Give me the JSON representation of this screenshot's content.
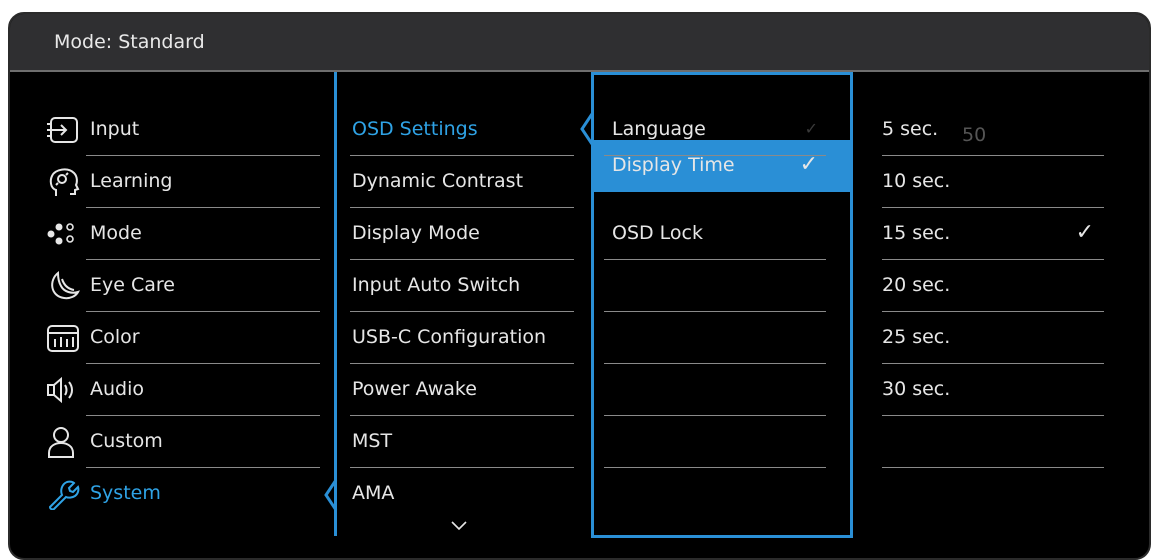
{
  "header": {
    "mode_label": "Mode: Standard"
  },
  "main_menu": [
    {
      "label": "Input",
      "icon": "input-icon"
    },
    {
      "label": "Learning",
      "icon": "learning-icon"
    },
    {
      "label": "Mode",
      "icon": "mode-icon"
    },
    {
      "label": "Eye Care",
      "icon": "eye-care-icon"
    },
    {
      "label": "Color",
      "icon": "color-icon"
    },
    {
      "label": "Audio",
      "icon": "audio-icon"
    },
    {
      "label": "Custom",
      "icon": "custom-icon"
    },
    {
      "label": "System",
      "icon": "system-icon",
      "selected": true
    }
  ],
  "system_menu": [
    {
      "label": "OSD Settings",
      "selected": true
    },
    {
      "label": "Dynamic Contrast"
    },
    {
      "label": "Display Mode"
    },
    {
      "label": "Input Auto Switch"
    },
    {
      "label": "USB-C Configuration"
    },
    {
      "label": "Power Awake"
    },
    {
      "label": "MST"
    },
    {
      "label": "AMA"
    }
  ],
  "osd_menu": [
    {
      "label": "Language",
      "check": "✓"
    },
    {
      "label": "Display Time",
      "check": "✓",
      "highlighted": true
    },
    {
      "label": "OSD Lock"
    }
  ],
  "display_time_options": [
    {
      "label": "5 sec."
    },
    {
      "label": "10 sec."
    },
    {
      "label": "15 sec.",
      "check": "✓",
      "selected": true
    },
    {
      "label": "20 sec."
    },
    {
      "label": "25 sec."
    },
    {
      "label": "30 sec."
    }
  ],
  "ghost_value": "50",
  "colors": {
    "accent": "#2a8fd6",
    "accent_text": "#2fa3e6",
    "background": "#000000",
    "header": "#2f2f31"
  }
}
